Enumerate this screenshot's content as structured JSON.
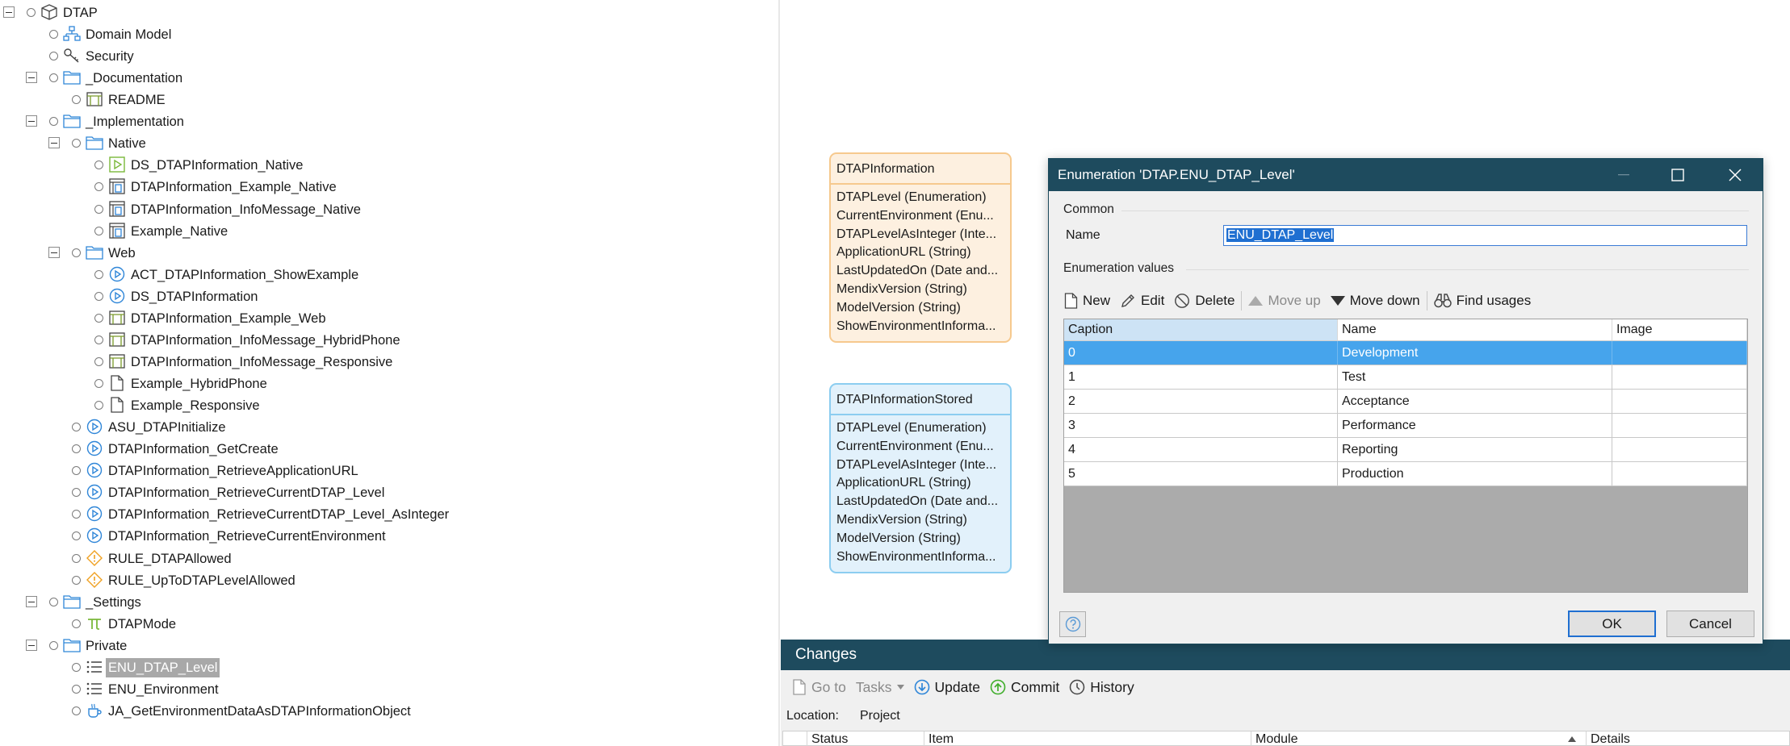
{
  "tree": {
    "items": [
      {
        "label": "DTAP",
        "icon": "module-box-icon"
      },
      {
        "label": "Domain Model",
        "icon": "domain-model-icon"
      },
      {
        "label": "Security",
        "icon": "security-key-icon"
      },
      {
        "label": "_Documentation",
        "icon": "folder-icon"
      },
      {
        "label": "README",
        "icon": "page-layout-icon"
      },
      {
        "label": "_Implementation",
        "icon": "folder-icon"
      },
      {
        "label": "Native",
        "icon": "folder-icon"
      },
      {
        "label": "DS_DTAPInformation_Native",
        "icon": "nanoflow-icon"
      },
      {
        "label": "DTAPInformation_Example_Native",
        "icon": "native-page-icon"
      },
      {
        "label": "DTAPInformation_InfoMessage_Native",
        "icon": "native-page-icon"
      },
      {
        "label": "Example_Native",
        "icon": "native-page-icon"
      },
      {
        "label": "Web",
        "icon": "folder-icon"
      },
      {
        "label": "ACT_DTAPInformation_ShowExample",
        "icon": "microflow-icon"
      },
      {
        "label": "DS_DTAPInformation",
        "icon": "microflow-icon"
      },
      {
        "label": "DTAPInformation_Example_Web",
        "icon": "page-layout-icon"
      },
      {
        "label": "DTAPInformation_InfoMessage_HybridPhone",
        "icon": "page-layout-icon"
      },
      {
        "label": "DTAPInformation_InfoMessage_Responsive",
        "icon": "page-layout-icon"
      },
      {
        "label": "Example_HybridPhone",
        "icon": "document-icon"
      },
      {
        "label": "Example_Responsive",
        "icon": "document-icon"
      },
      {
        "label": "ASU_DTAPInitialize",
        "icon": "microflow-icon"
      },
      {
        "label": "DTAPInformation_GetCreate",
        "icon": "microflow-icon"
      },
      {
        "label": "DTAPInformation_RetrieveApplicationURL",
        "icon": "microflow-icon"
      },
      {
        "label": "DTAPInformation_RetrieveCurrentDTAP_Level",
        "icon": "microflow-icon"
      },
      {
        "label": "DTAPInformation_RetrieveCurrentDTAP_Level_AsInteger",
        "icon": "microflow-icon"
      },
      {
        "label": "DTAPInformation_RetrieveCurrentEnvironment",
        "icon": "microflow-icon"
      },
      {
        "label": "RULE_DTAPAllowed",
        "icon": "rule-icon"
      },
      {
        "label": "RULE_UpToDTAPLevelAllowed",
        "icon": "rule-icon"
      },
      {
        "label": "_Settings",
        "icon": "folder-icon"
      },
      {
        "label": "DTAPMode",
        "icon": "constant-pi-icon"
      },
      {
        "label": "Private",
        "icon": "folder-icon"
      },
      {
        "label": "ENU_DTAP_Level",
        "icon": "enumeration-list-icon"
      },
      {
        "label": "ENU_Environment",
        "icon": "enumeration-list-icon"
      },
      {
        "label": "JA_GetEnvironmentDataAsDTAPInformationObject",
        "icon": "java-action-cup-icon"
      }
    ]
  },
  "entities": [
    {
      "title": "DTAPInformation",
      "attributes": [
        "DTAPLevel (Enumeration)",
        "CurrentEnvironment (Enu...",
        "DTAPLevelAsInteger (Inte...",
        "ApplicationURL (String)",
        "LastUpdatedOn (Date and...",
        "MendixVersion (String)",
        "ModelVersion (String)",
        "ShowEnvironmentInforma..."
      ]
    },
    {
      "title": "DTAPInformationStored",
      "attributes": [
        "DTAPLevel (Enumeration)",
        "CurrentEnvironment (Enu...",
        "DTAPLevelAsInteger (Inte...",
        "ApplicationURL (String)",
        "LastUpdatedOn (Date and...",
        "MendixVersion (String)",
        "ModelVersion (String)",
        "ShowEnvironmentInforma..."
      ]
    }
  ],
  "dialog": {
    "title": "Enumeration 'DTAP.ENU_DTAP_Level'",
    "common_label": "Common",
    "name_label": "Name",
    "name_value": "ENU_DTAP_Level",
    "values_label": "Enumeration values",
    "toolbar": {
      "new": "New",
      "edit": "Edit",
      "delete": "Delete",
      "move_up": "Move up",
      "move_down": "Move down",
      "find_usages": "Find usages"
    },
    "columns": [
      "Caption",
      "Name",
      "Image"
    ],
    "rows": [
      {
        "caption": "0",
        "name": "Development",
        "image": ""
      },
      {
        "caption": "1",
        "name": "Test",
        "image": ""
      },
      {
        "caption": "2",
        "name": "Acceptance",
        "image": ""
      },
      {
        "caption": "3",
        "name": "Performance",
        "image": ""
      },
      {
        "caption": "4",
        "name": "Reporting",
        "image": ""
      },
      {
        "caption": "5",
        "name": "Production",
        "image": ""
      }
    ],
    "ok_label": "OK",
    "cancel_label": "Cancel"
  },
  "changes": {
    "title": "Changes",
    "toolbar": {
      "go_to": "Go to",
      "tasks": "Tasks",
      "update": "Update",
      "commit": "Commit",
      "history": "History"
    },
    "location_label": "Location:",
    "location_value": "Project",
    "columns": [
      "Status",
      "Item",
      "Module",
      "Details"
    ]
  },
  "colors": {
    "title_bar": "#1e4b5e",
    "selection": "#46a4ec",
    "entity_orange": "#fdf0e0",
    "entity_blue": "#e2f1fb"
  }
}
